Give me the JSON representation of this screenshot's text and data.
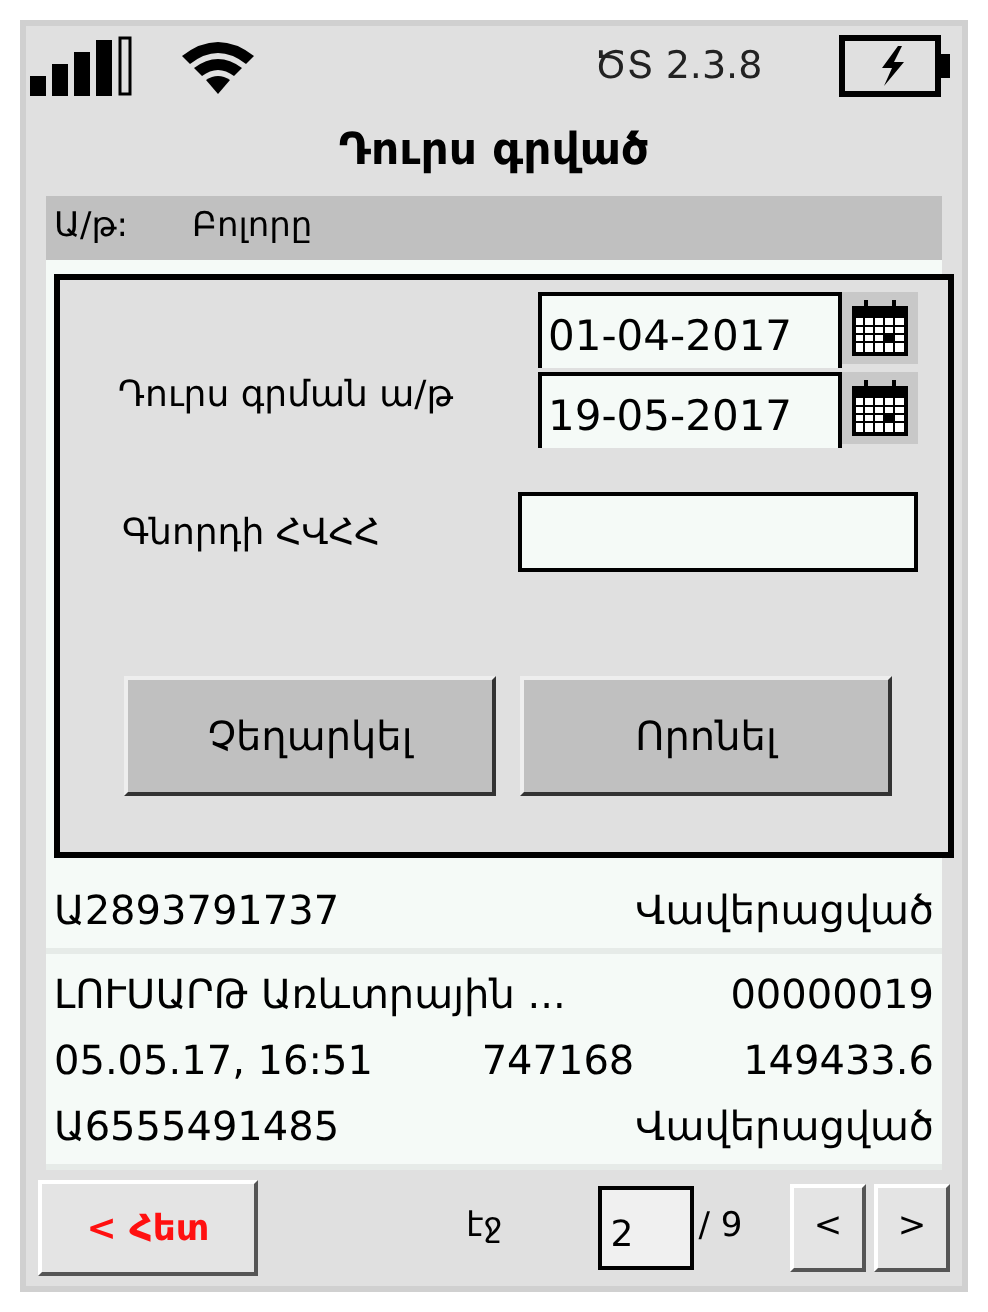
{
  "status_bar": {
    "version": "ԾՏ 2.3.8"
  },
  "title": "Դուրս գրված",
  "filter": {
    "label": "Ա/թ:",
    "value": "Բոլորը"
  },
  "rows": [
    {
      "id": "Ա2893791737",
      "status": "Վավերացված"
    },
    {
      "name": "ԼՈՒՍԱՐԹ Առևտրային ...",
      "code": "00000019",
      "date": "05.05.17, 16:51",
      "number": "747168",
      "amount": "149433.6",
      "id": "Ա6555491485",
      "status": "Վավերացված"
    }
  ],
  "dialog": {
    "date_label": "Դուրս գրման ա/թ",
    "date_from": "01-04-2017",
    "date_to": "19-05-2017",
    "buyer_label": "Գնորդի ՀՎՀՀ",
    "buttons": [
      "Չեղարկել",
      "Որոնել"
    ]
  },
  "footer": {
    "back": "< Հետ",
    "page_label": "էջ",
    "page": "2",
    "total": "/ 9",
    "prev": "<",
    "next": ">"
  }
}
